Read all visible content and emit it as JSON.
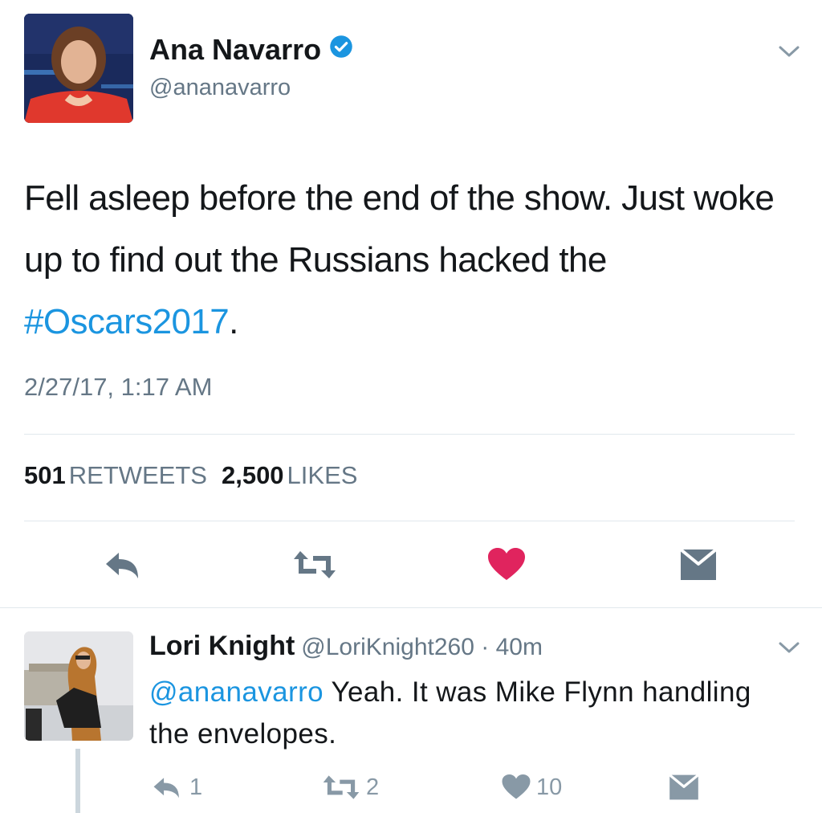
{
  "tweet": {
    "author_name": "Ana Navarro",
    "author_handle": "@ananavarro",
    "text_before": "Fell asleep before the end of the show. Just woke up to find out the Russians hacked the ",
    "hashtag": "#Oscars2017",
    "text_after": ".",
    "timestamp": "2/27/17, 1:17 AM",
    "retweets_count": "501",
    "retweets_label": "RETWEETS",
    "likes_count": "2,500",
    "likes_label": "LIKES",
    "liked": true
  },
  "reply": {
    "author_name": "Lori Knight",
    "author_handle": "@LoriKnight260",
    "separator": " · ",
    "time": "40m",
    "mention": "@ananavarro",
    "text": " Yeah. It was Mike Flynn handling the envelopes.",
    "reply_count": "1",
    "retweet_count": "2",
    "like_count": "10"
  },
  "colors": {
    "link_blue": "#1b95e0",
    "like_red": "#e0245e",
    "icon_gray": "#657786",
    "muted_gray": "#8899a6"
  }
}
